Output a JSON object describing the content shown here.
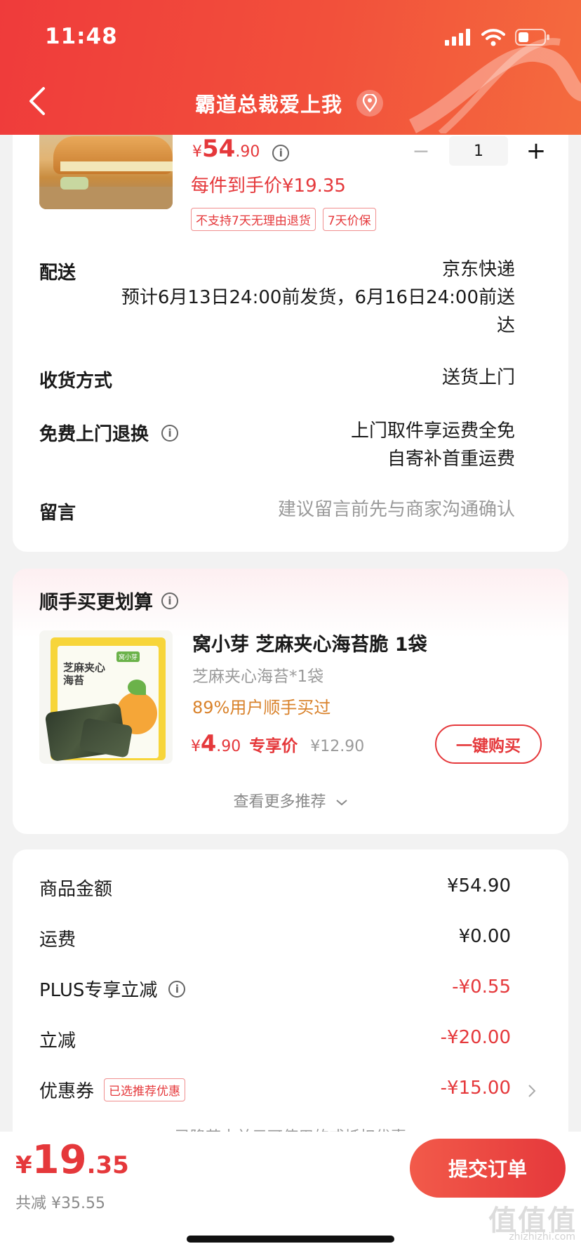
{
  "status_bar": {
    "time": "11:48"
  },
  "nav": {
    "title": "霸道总裁爱上我"
  },
  "product": {
    "price_symbol": "¥",
    "price_int": "54",
    "price_dec": ".90",
    "quantity": "1",
    "each_price": "每件到手价¥19.35",
    "tags": [
      "不支持7天无理由退货",
      "7天价保"
    ]
  },
  "delivery": {
    "label": "配送",
    "carrier": "京东快递",
    "estimate_line1": "预计6月13日24:00前发货，6月16日24:00前送",
    "estimate_line2": "达"
  },
  "receive": {
    "label": "收货方式",
    "value": "送货上门"
  },
  "free_return": {
    "label": "免费上门退换",
    "value_line1": "上门取件享运费全免",
    "value_line2": "自寄补首重运费"
  },
  "message": {
    "label": "留言",
    "placeholder": "建议留言前先与商家沟通确认"
  },
  "recommend": {
    "title": "顺手买更划算",
    "name": "窝小芽 芝麻夹心海苔脆 1袋",
    "spec": "芝麻夹心海苔*1袋",
    "bought": "89%用户顺手买过",
    "price_symbol": "¥",
    "price_int": "4",
    "price_dec": ".90",
    "price_tag": "专享价",
    "original_price": "¥12.90",
    "buy_label": "一键购买",
    "more_label": "查看更多推荐",
    "pack_text_line1": "芝麻夹心",
    "pack_text_line2": "海苔",
    "pack_brand": "窝小芽"
  },
  "summary": {
    "rows": [
      {
        "label": "商品金额",
        "value": "¥54.90"
      },
      {
        "label": "运费",
        "value": "¥0.00"
      },
      {
        "label": "PLUS专享立减",
        "value": "-¥0.55"
      },
      {
        "label": "立减",
        "value": "-¥20.00"
      },
      {
        "label": "优惠券",
        "value": "-¥15.00",
        "badge": "已选推荐优惠"
      }
    ],
    "partial_text": "已降若十并元可使用的或抵扣优惠"
  },
  "footer": {
    "price_symbol": "¥",
    "price_int": "19",
    "price_dec": ".35",
    "saved": "共减 ¥35.55",
    "submit_label": "提交订单"
  },
  "watermark": {
    "brand": "值值值",
    "domain": "zhizhizhi.com"
  },
  "colors": {
    "accent": "#e5383b",
    "header_start": "#ef3b3b",
    "header_end": "#f46b3e",
    "bought": "#d9822b"
  }
}
